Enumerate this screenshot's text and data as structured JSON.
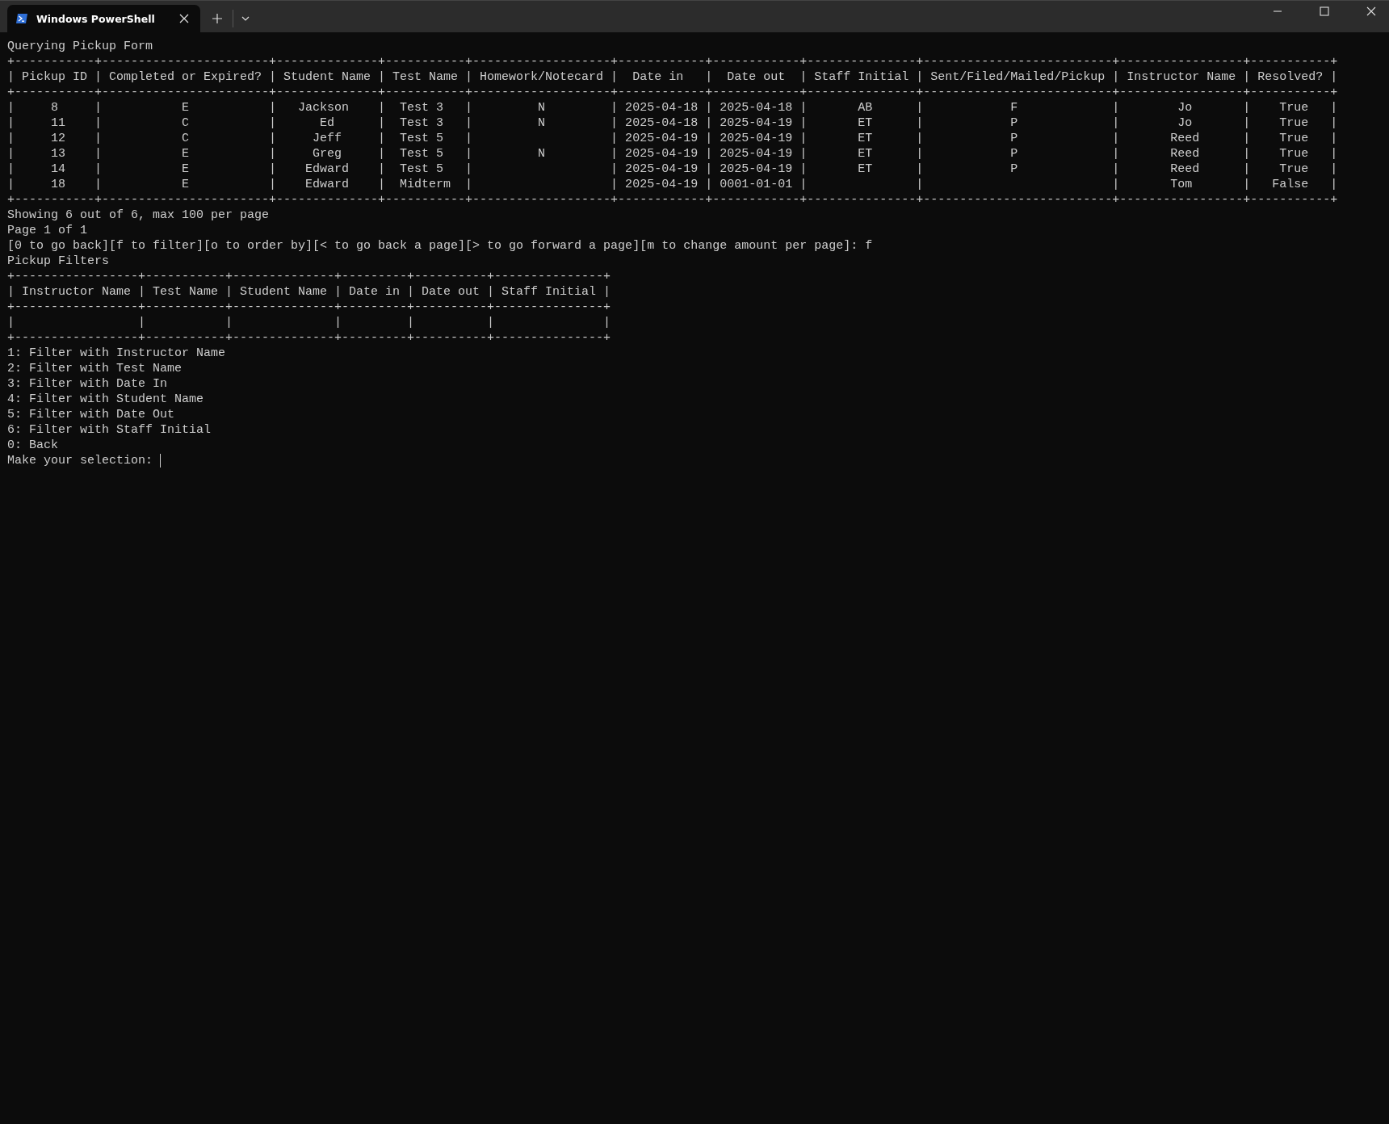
{
  "window": {
    "tab_title": "Windows PowerShell"
  },
  "terminal": {
    "lines": [
      "Querying Pickup Form",
      "+-----------+-----------------------+--------------+-----------+-------------------+------------+------------+---------------+--------------------------+-----------------+-----------+",
      "| Pickup ID | Completed or Expired? | Student Name | Test Name | Homework/Notecard |  Date in   |  Date out  | Staff Initial | Sent/Filed/Mailed/Pickup | Instructor Name | Resolved? |",
      "+-----------+-----------------------+--------------+-----------+-------------------+------------+------------+---------------+--------------------------+-----------------+-----------+",
      "|     8     |           E           |   Jackson    |  Test 3   |         N         | 2025-04-18 | 2025-04-18 |       AB      |            F             |        Jo       |    True   |",
      "|     11    |           C           |      Ed      |  Test 3   |         N         | 2025-04-18 | 2025-04-19 |       ET      |            P             |        Jo       |    True   |",
      "|     12    |           C           |     Jeff     |  Test 5   |                   | 2025-04-19 | 2025-04-19 |       ET      |            P             |       Reed      |    True   |",
      "|     13    |           E           |     Greg     |  Test 5   |         N         | 2025-04-19 | 2025-04-19 |       ET      |            P             |       Reed      |    True   |",
      "|     14    |           E           |    Edward    |  Test 5   |                   | 2025-04-19 | 2025-04-19 |       ET      |            P             |       Reed      |    True   |",
      "|     18    |           E           |    Edward    |  Midterm  |                   | 2025-04-19 | 0001-01-01 |               |                          |       Tom       |   False   |",
      "+-----------+-----------------------+--------------+-----------+-------------------+------------+------------+---------------+--------------------------+-----------------+-----------+",
      "Showing 6 out of 6, max 100 per page",
      "Page 1 of 1",
      "[0 to go back][f to filter][o to order by][< to go back a page][> to go forward a page][m to change amount per page]: f",
      "Pickup Filters",
      "+-----------------+-----------+--------------+---------+----------+---------------+",
      "| Instructor Name | Test Name | Student Name | Date in | Date out | Staff Initial |",
      "+-----------------+-----------+--------------+---------+----------+---------------+",
      "|                 |           |              |         |          |               |",
      "+-----------------+-----------+--------------+---------+----------+---------------+",
      "1: Filter with Instructor Name",
      "2: Filter with Test Name",
      "3: Filter with Date In",
      "4: Filter with Student Name",
      "5: Filter with Date Out",
      "6: Filter with Staff Initial",
      "0: Back"
    ],
    "prompt": "Make your selection:"
  }
}
